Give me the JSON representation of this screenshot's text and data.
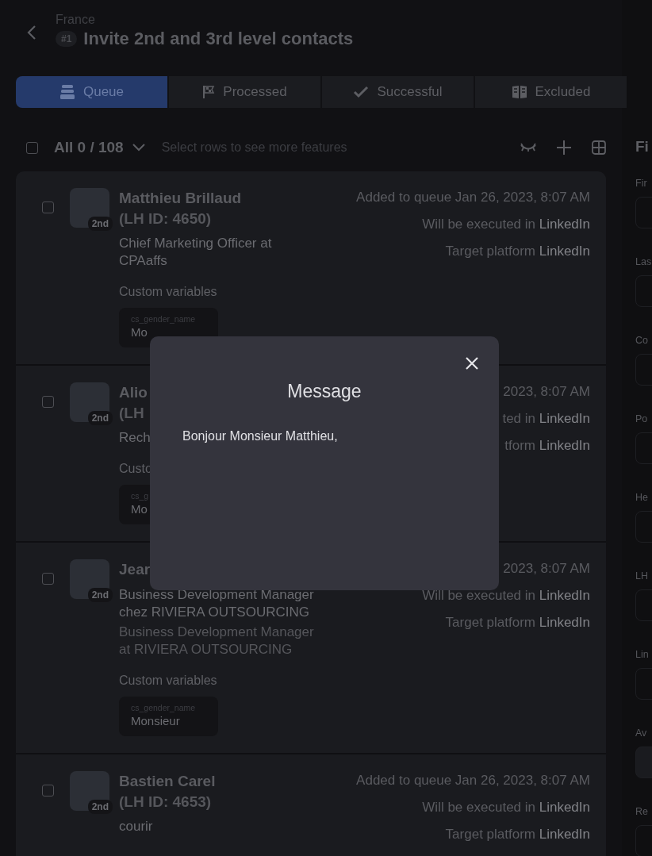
{
  "header": {
    "breadcrumb": "France",
    "number": "#1",
    "title": "Invite 2nd and 3rd level contacts"
  },
  "tabs": [
    {
      "label": "Queue",
      "selected": true
    },
    {
      "label": "Processed",
      "selected": false
    },
    {
      "label": "Successful",
      "selected": false
    },
    {
      "label": "Excluded",
      "selected": false
    }
  ],
  "toolbar": {
    "checked": false,
    "count": "All 0 / 108",
    "hint": "Select rows to see more features"
  },
  "contacts": [
    {
      "checked": false,
      "name": "Matthieu Brillaud",
      "lh_id": "(LH ID: 4650)",
      "degree": "2nd",
      "lines": [
        "Chief Marketing Officer at CPAaffs"
      ],
      "custom_label": "Custom variables",
      "vars": [
        {
          "key": "cs_gender_name",
          "value": "Mo"
        }
      ],
      "added": "Added to queue Jan 26, 2023, 8:07 AM",
      "executed_label": "Will be executed in",
      "executed_value": "LinkedIn",
      "target_label": "Target platform",
      "target_value": "LinkedIn"
    },
    {
      "checked": false,
      "name": "Alio",
      "lh_id": "(LH",
      "degree": "2nd",
      "lines": [
        "Rech"
      ],
      "custom_label": "Custo",
      "vars": [
        {
          "key": "cs_g",
          "value": "Mo"
        }
      ],
      "added": "2023, 8:07 AM",
      "executed_label": "ted in",
      "executed_value": "LinkedIn",
      "target_label": "tform",
      "target_value": "LinkedIn"
    },
    {
      "checked": false,
      "name": "Jear",
      "degree": "2nd",
      "lines": [
        "Business Development Manager chez RIVIERA OUTSOURCING"
      ],
      "dim_lines": [
        "Business Development Manager at RIVIERA OUTSOURCING"
      ],
      "custom_label": "Custom variables",
      "vars": [
        {
          "key": "cs_gender_name",
          "value": "Monsieur"
        }
      ],
      "added": "2023, 8:07 AM",
      "executed_label": "Will be executed in",
      "executed_value": "LinkedIn",
      "target_label": "Target platform",
      "target_value": "LinkedIn"
    },
    {
      "checked": false,
      "name": "Bastien Carel",
      "lh_id": "(LH ID: 4653)",
      "degree": "2nd",
      "lines": [
        "courir"
      ],
      "added": "Added to queue Jan 26, 2023, 8:07 AM",
      "executed_label": "Will be executed in",
      "executed_value": "LinkedIn",
      "target_label": "Target platform",
      "target_value": "LinkedIn"
    }
  ],
  "filters": {
    "title": "Fi",
    "fields": [
      {
        "label": "Fir",
        "kind": "text"
      },
      {
        "label": "Las",
        "kind": "text"
      },
      {
        "label": "Co",
        "kind": "text"
      },
      {
        "label": "Po",
        "kind": "text"
      },
      {
        "label": "He",
        "kind": "text"
      },
      {
        "label": "LH",
        "kind": "text"
      },
      {
        "label": "Lin",
        "kind": "text"
      },
      {
        "label": "Av",
        "kind": "select"
      },
      {
        "label": "Re",
        "kind": "text"
      }
    ]
  },
  "modal": {
    "title": "Message",
    "body": "Bonjour Monsieur Matthieu,"
  }
}
